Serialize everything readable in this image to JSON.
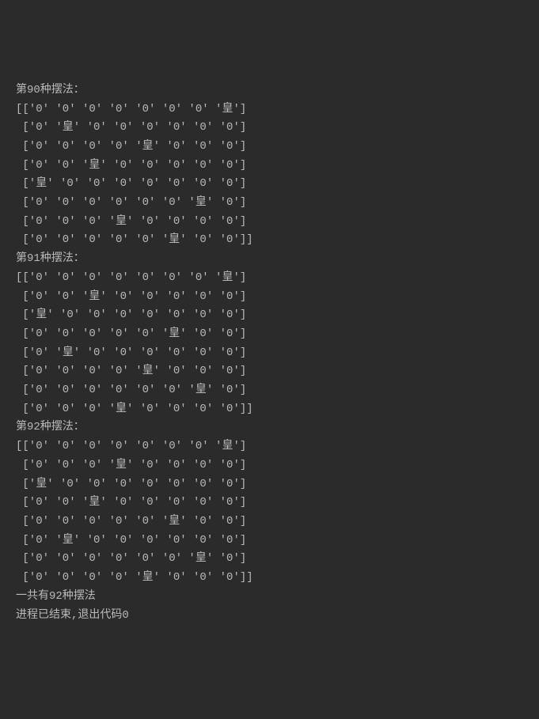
{
  "output": {
    "lines": [
      "第90种摆法：",
      "[['0' '0' '0' '0' '0' '0' '0' '皇']",
      " ['0' '皇' '0' '0' '0' '0' '0' '0']",
      " ['0' '0' '0' '0' '皇' '0' '0' '0']",
      " ['0' '0' '皇' '0' '0' '0' '0' '0']",
      " ['皇' '0' '0' '0' '0' '0' '0' '0']",
      " ['0' '0' '0' '0' '0' '0' '皇' '0']",
      " ['0' '0' '0' '皇' '0' '0' '0' '0']",
      " ['0' '0' '0' '0' '0' '皇' '0' '0']]",
      "第91种摆法：",
      "[['0' '0' '0' '0' '0' '0' '0' '皇']",
      " ['0' '0' '皇' '0' '0' '0' '0' '0']",
      " ['皇' '0' '0' '0' '0' '0' '0' '0']",
      " ['0' '0' '0' '0' '0' '皇' '0' '0']",
      " ['0' '皇' '0' '0' '0' '0' '0' '0']",
      " ['0' '0' '0' '0' '皇' '0' '0' '0']",
      " ['0' '0' '0' '0' '0' '0' '皇' '0']",
      " ['0' '0' '0' '皇' '0' '0' '0' '0']]",
      "第92种摆法：",
      "[['0' '0' '0' '0' '0' '0' '0' '皇']",
      " ['0' '0' '0' '皇' '0' '0' '0' '0']",
      " ['皇' '0' '0' '0' '0' '0' '0' '0']",
      " ['0' '0' '皇' '0' '0' '0' '0' '0']",
      " ['0' '0' '0' '0' '0' '皇' '0' '0']",
      " ['0' '皇' '0' '0' '0' '0' '0' '0']",
      " ['0' '0' '0' '0' '0' '0' '皇' '0']",
      " ['0' '0' '0' '0' '皇' '0' '0' '0']]",
      "一共有92种摆法",
      "",
      "进程已结束,退出代码0"
    ]
  }
}
